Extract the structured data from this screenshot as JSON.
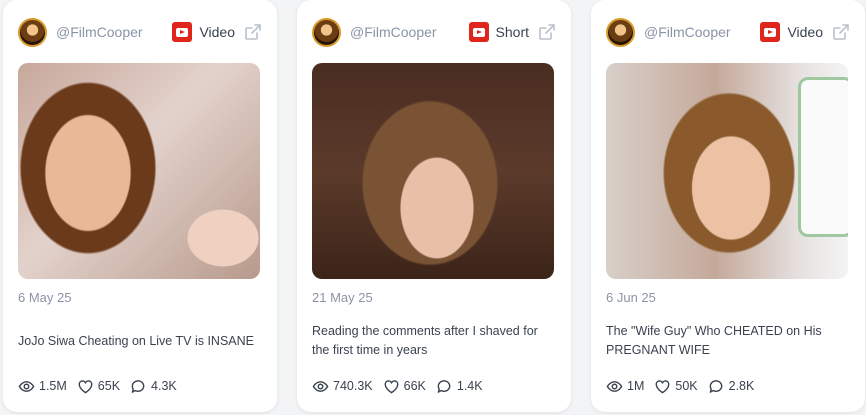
{
  "cards": [
    {
      "handle": "@FilmCooper",
      "type_label": "Video",
      "date": "6 May 25",
      "title": "JoJo Siwa Cheating on Live TV is INSANE",
      "views": "1.5M",
      "likes": "65K",
      "comments": "4.3K"
    },
    {
      "handle": "@FilmCooper",
      "type_label": "Short",
      "date": "21 May 25",
      "title": "Reading the comments after I shaved for the first time in years",
      "views": "740.3K",
      "likes": "66K",
      "comments": "1.4K"
    },
    {
      "handle": "@FilmCooper",
      "type_label": "Video",
      "date": "6 Jun 25",
      "title": "The \"Wife Guy\" Who CHEATED on His PREGNANT WIFE",
      "views": "1M",
      "likes": "50K",
      "comments": "2.8K"
    }
  ],
  "colors": {
    "youtube_red": "#e0261c",
    "muted_text": "#8a94a6",
    "body_text": "#3a4250",
    "card_bg": "#ffffff"
  },
  "icons": [
    "youtube-icon",
    "external-link-icon",
    "eye-icon",
    "heart-icon",
    "comment-icon"
  ]
}
